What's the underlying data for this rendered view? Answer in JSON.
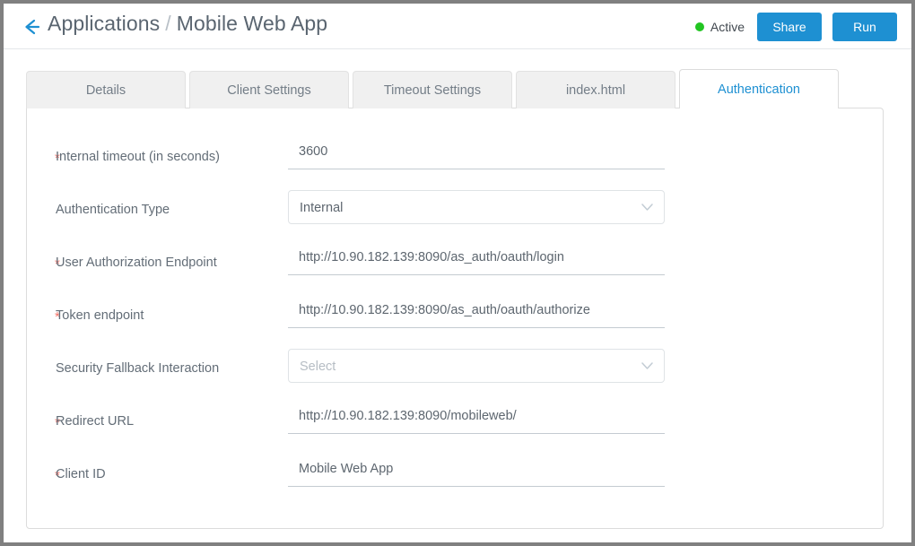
{
  "header": {
    "back_icon": "arrow-left-icon",
    "breadcrumb": {
      "parent": "Applications",
      "separator": "/",
      "current": "Mobile Web App"
    },
    "status": {
      "label": "Active",
      "dot_color": "#22c522"
    },
    "buttons": {
      "share": "Share",
      "run": "Run"
    },
    "accent_color": "#1e90d2"
  },
  "tabs": [
    {
      "label": "Details",
      "active": false
    },
    {
      "label": "Client Settings",
      "active": false
    },
    {
      "label": "Timeout Settings",
      "active": false
    },
    {
      "label": "index.html",
      "active": false
    },
    {
      "label": "Authentication",
      "active": true
    }
  ],
  "form": {
    "required_marker": "*",
    "fields": [
      {
        "label": "Internal timeout (in seconds)",
        "required": true,
        "control": "text",
        "value": "3600",
        "placeholder": ""
      },
      {
        "label": "Authentication Type",
        "required": false,
        "control": "select",
        "value": "Internal",
        "placeholder": ""
      },
      {
        "label": "User Authorization Endpoint",
        "required": true,
        "control": "text",
        "value": "http://10.90.182.139:8090/as_auth/oauth/login",
        "placeholder": ""
      },
      {
        "label": "Token endpoint",
        "required": true,
        "control": "text",
        "value": "http://10.90.182.139:8090/as_auth/oauth/authorize",
        "placeholder": ""
      },
      {
        "label": "Security Fallback Interaction",
        "required": false,
        "control": "select",
        "value": "",
        "placeholder": "Select"
      },
      {
        "label": "Redirect URL",
        "required": true,
        "control": "text",
        "value": "http://10.90.182.139:8090/mobileweb/",
        "placeholder": ""
      },
      {
        "label": "Client ID",
        "required": true,
        "control": "text",
        "value": "Mobile Web App",
        "placeholder": ""
      }
    ]
  }
}
